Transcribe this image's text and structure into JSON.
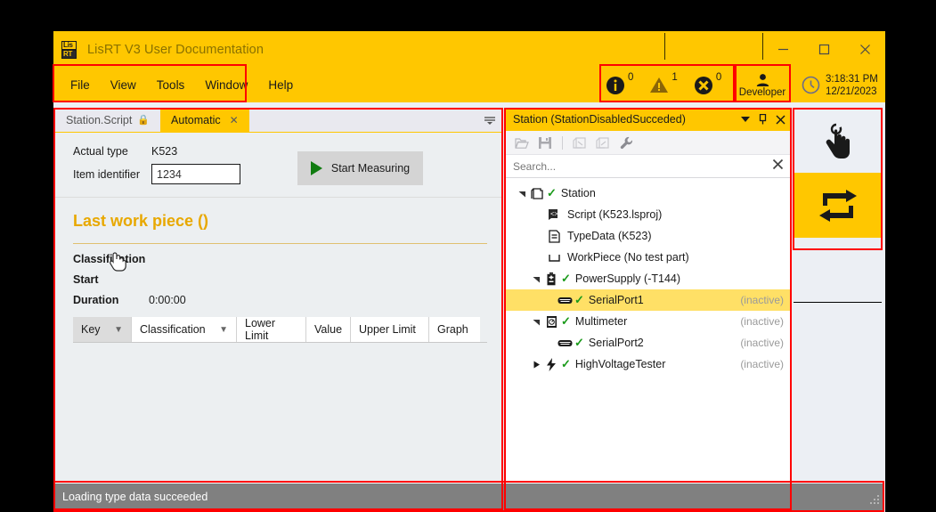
{
  "window": {
    "title": "LisRT V3 User Documentation",
    "app_icon": "lisrt-logo-icon",
    "icon_top": "Lis",
    "icon_bottom": "RT",
    "minimize": "minimize-icon",
    "maximize": "maximize-icon",
    "close": "close-icon",
    "accent_color": "#FFC700"
  },
  "menu": {
    "items": [
      {
        "label": "File"
      },
      {
        "label": "View"
      },
      {
        "label": "Tools"
      },
      {
        "label": "Window"
      },
      {
        "label": "Help"
      }
    ]
  },
  "status_indicators": {
    "info": {
      "icon": "info-icon",
      "count": "0"
    },
    "warning": {
      "icon": "warning-triangle-icon",
      "count": "1"
    },
    "error": {
      "icon": "error-circle-icon",
      "count": "0"
    }
  },
  "user": {
    "icon": "person-icon",
    "label": "Developer"
  },
  "clock": {
    "icon": "clock-icon",
    "time": "3:18:31 PM",
    "date": "12/21/2023"
  },
  "document_tabs": [
    {
      "label": "Station.Script",
      "icon": "lock-icon",
      "active": false
    },
    {
      "label": "Automatic",
      "icon": "close-icon",
      "active": true
    }
  ],
  "automatic_view": {
    "actual_type_label": "Actual type",
    "actual_type_value": "K523",
    "item_identifier_label": "Item identifier",
    "item_identifier_value": "1234",
    "start_button": "Start Measuring",
    "heading": "Last work piece ()",
    "fields": [
      {
        "key": "Classification",
        "value": ""
      },
      {
        "key": "Start",
        "value": ""
      },
      {
        "key": "Duration",
        "value": "0:00:00"
      }
    ],
    "grid_headers": [
      {
        "label": "Key",
        "filter": true,
        "selected": true
      },
      {
        "label": "Classification",
        "filter": true,
        "selected": false
      },
      {
        "label": "Lower Limit",
        "filter": false,
        "selected": false
      },
      {
        "label": "Value",
        "filter": false,
        "selected": false
      },
      {
        "label": "Upper Limit",
        "filter": false,
        "selected": false
      },
      {
        "label": "Graph",
        "filter": false,
        "selected": false
      }
    ]
  },
  "station_panel": {
    "title": "Station (StationDisabledSucceded)",
    "title_icons": [
      "chevron-down-icon",
      "pin-icon",
      "close-icon"
    ],
    "toolbar": [
      {
        "name": "open-folder-icon",
        "enabled": true
      },
      {
        "name": "save-icon",
        "enabled": true
      },
      {
        "name": "import-icon",
        "enabled": false
      },
      {
        "name": "export-icon",
        "enabled": false
      },
      {
        "name": "wrench-icon",
        "enabled": true
      }
    ],
    "search_placeholder": "Search...",
    "search_clear": "clear-icon",
    "tree": [
      {
        "label": "Station",
        "icon": "station-icon",
        "check": true,
        "state": "",
        "indent": 0,
        "arrow": "down",
        "selected": false
      },
      {
        "label": "Script (K523.lsproj)",
        "icon": "script-icon",
        "check": false,
        "state": "",
        "indent": 1,
        "arrow": "",
        "selected": false
      },
      {
        "label": "TypeData (K523)",
        "icon": "document-icon",
        "check": false,
        "state": "",
        "indent": 1,
        "arrow": "",
        "selected": false
      },
      {
        "label": "WorkPiece (No test part)",
        "icon": "workpiece-icon",
        "check": false,
        "state": "",
        "indent": 1,
        "arrow": "",
        "selected": false
      },
      {
        "label": "PowerSupply (-T144)",
        "icon": "battery-icon",
        "check": true,
        "state": "",
        "indent": 1,
        "arrow": "down",
        "selected": false
      },
      {
        "label": "SerialPort1",
        "icon": "serialport-icon",
        "check": true,
        "state": "(inactive)",
        "indent": 2,
        "arrow": "",
        "selected": true
      },
      {
        "label": "Multimeter",
        "icon": "multimeter-icon",
        "check": true,
        "state": "(inactive)",
        "indent": 1,
        "arrow": "down",
        "selected": false
      },
      {
        "label": "SerialPort2",
        "icon": "serialport-icon",
        "check": true,
        "state": "(inactive)",
        "indent": 2,
        "arrow": "",
        "selected": false
      },
      {
        "label": "HighVoltageTester",
        "icon": "bolt-icon",
        "check": true,
        "state": "(inactive)",
        "indent": 1,
        "arrow": "right",
        "selected": false
      }
    ]
  },
  "sidebar": {
    "buttons": [
      {
        "name": "touch-hand-icon",
        "active": false
      },
      {
        "name": "repeat-arrows-icon",
        "active": true
      }
    ]
  },
  "statusbar": {
    "message": "Loading type data succeeded"
  }
}
